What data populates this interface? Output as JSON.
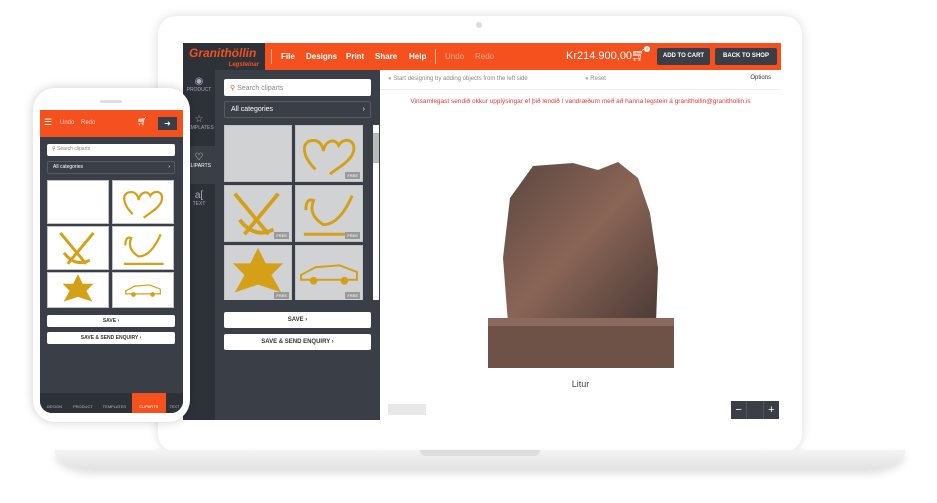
{
  "brand": {
    "name": "Granithöllin",
    "sub": "Legsteinar",
    "accent": "#f4511e"
  },
  "menu": [
    "File",
    "Designs",
    "Print",
    "Share",
    "Help"
  ],
  "undo": "Undo",
  "redo": "Redo",
  "price": "Kr214.900,00",
  "cart_badge": "0",
  "add_to_cart": "ADD TO CART",
  "back_to_shop": "BACK TO SHOP",
  "rail": [
    {
      "label": "PRODUCT",
      "icon": "product-icon"
    },
    {
      "label": "TEMPLATES",
      "icon": "star-icon"
    },
    {
      "label": "CLIPARTS",
      "icon": "heart-icon"
    },
    {
      "label": "TEXT",
      "icon": "text-icon"
    }
  ],
  "search_placeholder": "Search cliparts",
  "category": "All categories",
  "free": "FREE",
  "cliparts": [
    "blank",
    "hearts",
    "anchor",
    "swan",
    "star",
    "car"
  ],
  "save": "SAVE  ›",
  "save_send": "SAVE & SEND ENQUIRY  ›",
  "hint": "Start designing by adding objects from the left side",
  "reset": "Reset",
  "options": "Options",
  "notice": "Vinsamlegast sendið okkur upplýsingar ef þið lendið í vandræðum með að hanna legstein á granithollin@granithollin.is",
  "color_label": "Litur",
  "zoom_minus": "−",
  "zoom_plus": "+",
  "phone": {
    "nav": [
      "DESIGN",
      "PRODUCT",
      "TEMPLATES",
      "CLIPARTS",
      "TEXT"
    ],
    "active": "CLIPARTS"
  }
}
